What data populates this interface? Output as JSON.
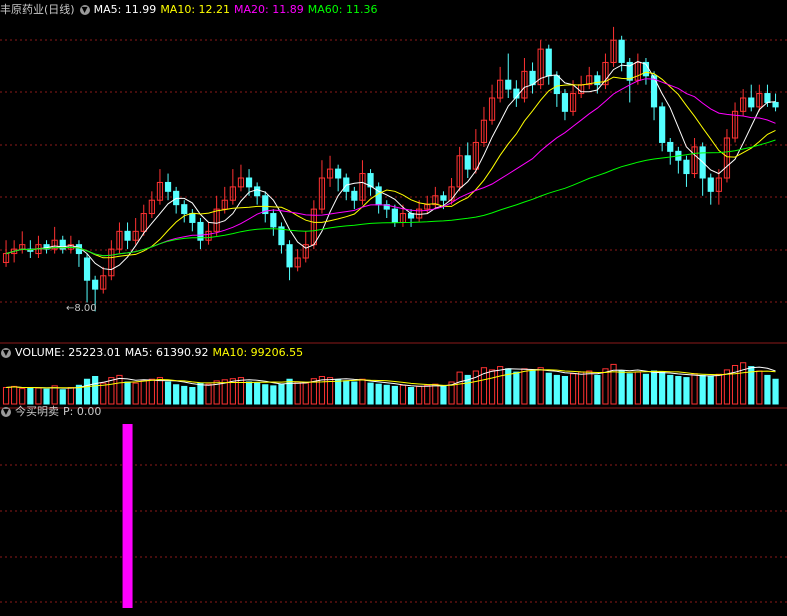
{
  "colors": {
    "background": "#000000",
    "grid": "#8b1a1a",
    "up": "#ff3232",
    "down": "#54ffff",
    "ma5": "#ffffff",
    "ma10": "#ffff00",
    "ma20": "#ff00ff",
    "ma60": "#00ff00",
    "signal": "#ff00ff",
    "title": "#c8c8c8"
  },
  "price_panel": {
    "title": "丰原药业(日线)",
    "toggle_icon": "chevron-down-icon",
    "ma5": "MA5: 11.99",
    "ma10": "MA10: 12.21",
    "ma20": "MA20: 11.89",
    "ma60": "MA60: 11.36",
    "min_label": "←8.00"
  },
  "volume_panel": {
    "label": "VOLUME: 25223.01",
    "ma5": "MA5: 61390.92",
    "ma10": "MA10: 99206.55"
  },
  "indicator_panel": {
    "label": "今买明卖",
    "value": "P: 0.00"
  },
  "chart_data": {
    "type": "candlestick",
    "y_range_price": [
      7.4,
      14.6
    ],
    "candles": [
      [
        9.1,
        9.3,
        9.6,
        9.0
      ],
      [
        9.3,
        9.4,
        9.6,
        9.1
      ],
      [
        9.4,
        9.5,
        9.8,
        9.3
      ],
      [
        9.4,
        9.35,
        9.6,
        9.2
      ],
      [
        9.3,
        9.5,
        9.7,
        9.2
      ],
      [
        9.5,
        9.4,
        9.6,
        9.3
      ],
      [
        9.4,
        9.6,
        9.9,
        9.3
      ],
      [
        9.6,
        9.4,
        9.7,
        9.3
      ],
      [
        9.4,
        9.5,
        9.7,
        9.3
      ],
      [
        9.5,
        9.3,
        9.6,
        9.0
      ],
      [
        9.2,
        8.7,
        9.3,
        8.2
      ],
      [
        8.7,
        8.5,
        8.8,
        8.0
      ],
      [
        8.5,
        8.8,
        9.0,
        8.4
      ],
      [
        8.8,
        9.4,
        9.6,
        8.7
      ],
      [
        9.4,
        9.8,
        10.0,
        9.3
      ],
      [
        9.8,
        9.6,
        10.0,
        9.4
      ],
      [
        9.6,
        9.8,
        10.1,
        9.5
      ],
      [
        9.8,
        10.2,
        10.4,
        9.7
      ],
      [
        10.2,
        10.5,
        10.7,
        10.1
      ],
      [
        10.5,
        10.9,
        11.2,
        10.4
      ],
      [
        10.9,
        10.7,
        11.1,
        10.5
      ],
      [
        10.7,
        10.4,
        10.8,
        10.2
      ],
      [
        10.4,
        10.2,
        10.5,
        10.0
      ],
      [
        10.2,
        10.0,
        10.3,
        9.8
      ],
      [
        10.0,
        9.6,
        10.1,
        9.4
      ],
      [
        9.6,
        9.8,
        10.0,
        9.5
      ],
      [
        9.8,
        10.3,
        10.6,
        9.7
      ],
      [
        10.3,
        10.5,
        10.8,
        10.2
      ],
      [
        10.5,
        10.8,
        11.2,
        10.4
      ],
      [
        10.8,
        11.0,
        11.3,
        10.7
      ],
      [
        11.0,
        10.8,
        11.2,
        10.6
      ],
      [
        10.8,
        10.6,
        10.9,
        10.4
      ],
      [
        10.6,
        10.2,
        10.7,
        10.0
      ],
      [
        10.2,
        9.9,
        10.3,
        9.7
      ],
      [
        9.9,
        9.5,
        10.0,
        9.3
      ],
      [
        9.5,
        9.0,
        9.6,
        8.7
      ],
      [
        9.0,
        9.2,
        9.4,
        8.9
      ],
      [
        9.2,
        9.5,
        9.8,
        9.1
      ],
      [
        9.5,
        10.3,
        10.5,
        9.4
      ],
      [
        10.3,
        11.0,
        11.4,
        10.2
      ],
      [
        11.0,
        11.2,
        11.5,
        10.8
      ],
      [
        11.2,
        11.0,
        11.3,
        10.7
      ],
      [
        11.0,
        10.7,
        11.1,
        10.5
      ],
      [
        10.7,
        10.5,
        10.8,
        10.3
      ],
      [
        10.5,
        11.1,
        11.4,
        10.4
      ],
      [
        11.1,
        10.8,
        11.2,
        10.6
      ],
      [
        10.8,
        10.4,
        10.9,
        10.2
      ],
      [
        10.4,
        10.3,
        10.5,
        10.1
      ],
      [
        10.3,
        10.0,
        10.4,
        9.9
      ],
      [
        10.0,
        10.2,
        10.4,
        9.9
      ],
      [
        10.2,
        10.1,
        10.3,
        9.9
      ],
      [
        10.1,
        10.3,
        10.5,
        10.0
      ],
      [
        10.3,
        10.4,
        10.6,
        10.2
      ],
      [
        10.4,
        10.6,
        10.8,
        10.3
      ],
      [
        10.6,
        10.5,
        10.7,
        10.3
      ],
      [
        10.5,
        10.8,
        11.0,
        10.4
      ],
      [
        10.8,
        11.5,
        11.7,
        10.7
      ],
      [
        11.5,
        11.2,
        11.8,
        11.0
      ],
      [
        11.2,
        11.8,
        12.1,
        11.1
      ],
      [
        11.8,
        12.3,
        12.6,
        11.7
      ],
      [
        12.3,
        12.8,
        13.1,
        12.2
      ],
      [
        12.8,
        13.2,
        13.5,
        12.7
      ],
      [
        13.2,
        13.0,
        13.8,
        12.8
      ],
      [
        13.0,
        12.8,
        13.2,
        12.6
      ],
      [
        12.8,
        13.4,
        13.7,
        12.7
      ],
      [
        13.4,
        13.1,
        13.6,
        12.9
      ],
      [
        13.1,
        13.9,
        14.1,
        13.0
      ],
      [
        13.9,
        13.3,
        14.0,
        13.1
      ],
      [
        13.3,
        12.9,
        13.4,
        12.6
      ],
      [
        12.9,
        12.5,
        13.0,
        12.3
      ],
      [
        12.5,
        12.9,
        13.2,
        12.4
      ],
      [
        12.9,
        13.1,
        13.3,
        12.8
      ],
      [
        13.1,
        13.3,
        13.5,
        13.0
      ],
      [
        13.3,
        13.1,
        13.4,
        12.9
      ],
      [
        13.1,
        13.6,
        13.8,
        13.0
      ],
      [
        13.6,
        14.1,
        14.4,
        13.5
      ],
      [
        14.1,
        13.6,
        14.2,
        13.4
      ],
      [
        13.6,
        13.2,
        13.7,
        12.7
      ],
      [
        13.2,
        13.6,
        13.8,
        13.1
      ],
      [
        13.6,
        13.3,
        13.7,
        13.1
      ],
      [
        13.3,
        12.6,
        13.4,
        12.3
      ],
      [
        12.6,
        11.8,
        12.7,
        11.6
      ],
      [
        11.8,
        11.6,
        11.9,
        11.3
      ],
      [
        11.6,
        11.4,
        11.7,
        11.1
      ],
      [
        11.4,
        11.1,
        11.5,
        10.8
      ],
      [
        11.1,
        11.7,
        11.9,
        11.0
      ],
      [
        11.7,
        11.0,
        11.8,
        10.6
      ],
      [
        11.0,
        10.7,
        11.1,
        10.4
      ],
      [
        10.7,
        11.0,
        11.2,
        10.4
      ],
      [
        11.0,
        11.9,
        12.1,
        10.9
      ],
      [
        11.9,
        12.5,
        12.7,
        11.8
      ],
      [
        12.5,
        12.8,
        13.0,
        12.4
      ],
      [
        12.8,
        12.6,
        13.1,
        12.5
      ],
      [
        12.6,
        12.9,
        13.1,
        12.5
      ],
      [
        12.9,
        12.7,
        13.1,
        12.6
      ],
      [
        12.7,
        12.6,
        12.9,
        12.5
      ]
    ],
    "volume": [
      30,
      32,
      28,
      30,
      29,
      27,
      33,
      26,
      30,
      34,
      45,
      50,
      38,
      48,
      52,
      40,
      38,
      42,
      45,
      48,
      40,
      35,
      32,
      30,
      38,
      36,
      42,
      44,
      46,
      48,
      40,
      38,
      35,
      33,
      36,
      45,
      40,
      38,
      46,
      50,
      48,
      44,
      42,
      40,
      45,
      38,
      36,
      34,
      32,
      34,
      30,
      32,
      34,
      36,
      33,
      40,
      58,
      52,
      60,
      66,
      62,
      68,
      64,
      58,
      64,
      60,
      66,
      56,
      52,
      50,
      55,
      58,
      60,
      52,
      64,
      72,
      60,
      55,
      58,
      54,
      60,
      58,
      52,
      50,
      48,
      55,
      52,
      50,
      54,
      62,
      70,
      75,
      68,
      60,
      52,
      45
    ],
    "volume_max": 80,
    "signal": [
      0,
      0,
      0,
      0,
      0,
      0,
      0,
      0,
      0,
      0,
      0,
      0,
      0,
      0,
      0,
      1,
      0,
      0,
      0,
      0,
      0,
      0,
      0,
      0,
      0,
      0,
      0,
      0,
      0,
      0,
      0,
      0,
      0,
      0,
      0,
      0,
      0,
      0,
      0,
      0,
      0,
      0,
      0,
      0,
      0,
      0,
      0,
      0,
      0,
      0,
      0,
      0,
      0,
      0,
      0,
      0,
      0,
      0,
      0,
      0,
      0,
      0,
      0,
      0,
      0,
      0,
      0,
      0,
      0,
      0,
      0,
      0,
      0,
      0,
      0,
      0,
      0,
      0,
      0,
      0,
      0,
      0,
      0,
      0,
      0,
      0,
      0,
      0,
      0,
      0,
      0,
      0,
      0,
      0,
      0,
      0
    ]
  }
}
